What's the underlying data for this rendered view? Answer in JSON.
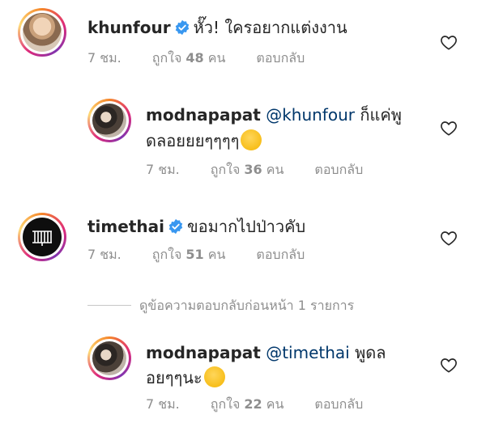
{
  "comments": [
    {
      "username": "khunfour",
      "verified": true,
      "mention": "",
      "text": "หั๊ว! ใครอยากแต่งงาน",
      "text_line2": "",
      "time": "7 ชม.",
      "likes_label": "ถูกใจ",
      "likes_count": "48",
      "likes_unit": "คน",
      "reply_label": "ตอบกลับ"
    },
    {
      "username": "modnapapat",
      "verified": false,
      "mention": "@khunfour",
      "text": "ก็แค่พู",
      "text_line2": "ดลอยยยๆๆๆๆ",
      "emoji": "shushing-face-emoji",
      "time": "7 ชม.",
      "likes_label": "ถูกใจ",
      "likes_count": "36",
      "likes_unit": "คน",
      "reply_label": "ตอบกลับ"
    },
    {
      "username": "timethai",
      "verified": true,
      "mention": "",
      "text": "ขอมากไปป่าวคับ",
      "text_line2": "",
      "time": "7 ชม.",
      "likes_label": "ถูกใจ",
      "likes_count": "51",
      "likes_unit": "คน",
      "reply_label": "ตอบกลับ"
    },
    {
      "username": "modnapapat",
      "verified": false,
      "mention": "@timethai",
      "text": "พูดล",
      "text_line2": "อยๆๆนะ",
      "emoji": "smirking-face-emoji",
      "time": "7 ชม.",
      "likes_label": "ถูกใจ",
      "likes_count": "22",
      "likes_unit": "คน",
      "reply_label": "ตอบกลับ"
    }
  ],
  "view_previous_replies": "ดูข้อความตอบกลับก่อนหน้า 1 รายการ",
  "colors": {
    "username": "#262626",
    "mention": "#00376b",
    "secondary": "#8e8e8e",
    "verified": "#3897f0"
  }
}
